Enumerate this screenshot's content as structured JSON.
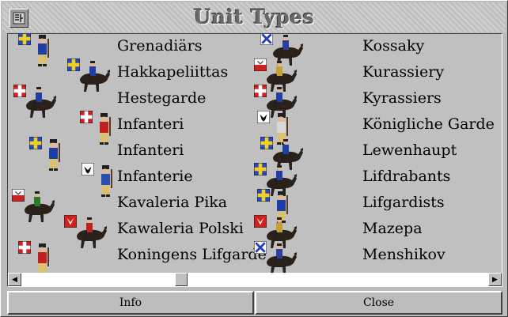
{
  "window": {
    "title": "Unit Types"
  },
  "units_left": [
    {
      "label": "Grenadiärs",
      "icon": "grenadier-icon",
      "flag": "swedish-cross",
      "mounted": false,
      "coat": "#1e3fa8"
    },
    {
      "label": "Hakkapeliittas",
      "icon": "cavalry-icon",
      "flag": "swedish-cross",
      "mounted": true,
      "coat": "#1e3fa8"
    },
    {
      "label": "Hestegarde",
      "icon": "cavalry-icon",
      "flag": "danish-cross",
      "mounted": true,
      "coat": "#1e3fa8"
    },
    {
      "label": "Infanteri",
      "icon": "infantry-icon",
      "flag": "danish-cross",
      "mounted": false,
      "coat": "#c02020"
    },
    {
      "label": "Infanteri",
      "icon": "infantry-icon",
      "flag": "swedish-cross",
      "mounted": false,
      "coat": "#1e3fa8"
    },
    {
      "label": "Infanterie",
      "icon": "infantry-icon",
      "flag": "eagle",
      "mounted": false,
      "coat": "#2a4fb0"
    },
    {
      "label": "Kavaleria Pika",
      "icon": "lancer-icon",
      "flag": "polish",
      "mounted": true,
      "coat": "#2a7a2a"
    },
    {
      "label": "Kawaleria Polski",
      "icon": "cavalry-icon",
      "flag": "polish-red",
      "mounted": true,
      "coat": "#c02020"
    },
    {
      "label": "Koningens Lifgarde",
      "icon": "infantry-icon",
      "flag": "danish-cross",
      "mounted": false,
      "coat": "#c02020"
    }
  ],
  "units_right": [
    {
      "label": "Kossaky",
      "icon": "cavalry-icon",
      "flag": "russian",
      "mounted": true,
      "coat": "#2a3fa0"
    },
    {
      "label": "Kurassiery",
      "icon": "cavalry-icon",
      "flag": "polish",
      "mounted": true,
      "coat": "#c8a030"
    },
    {
      "label": "Kyrassiers",
      "icon": "cavalry-icon",
      "flag": "danish-cross",
      "mounted": true,
      "coat": "#1e3fa8"
    },
    {
      "label": "Königliche Garde",
      "icon": "infantry-icon",
      "flag": "eagle",
      "mounted": false,
      "coat": "#d8d8d8"
    },
    {
      "label": "Lewenhaupt",
      "icon": "cavalry-icon",
      "flag": "swedish-cross",
      "mounted": true,
      "coat": "#1e3fa8"
    },
    {
      "label": "Lifdrabants",
      "icon": "cavalry-icon",
      "flag": "swedish-cross",
      "mounted": true,
      "coat": "#1e3fa8"
    },
    {
      "label": "Lifgardists",
      "icon": "grenadier-icon",
      "flag": "swedish-cross",
      "mounted": false,
      "coat": "#1e3fa8"
    },
    {
      "label": "Mazepa",
      "icon": "cavalry-icon",
      "flag": "polish-red",
      "mounted": true,
      "coat": "#c8a030"
    },
    {
      "label": "Menshikov",
      "icon": "cavalry-icon",
      "flag": "russian",
      "mounted": true,
      "coat": "#2a3fa0"
    }
  ],
  "scrollbar": {
    "left_arrow": "◀",
    "right_arrow": "▶"
  },
  "buttons": {
    "info": "Info",
    "close": "Close"
  }
}
